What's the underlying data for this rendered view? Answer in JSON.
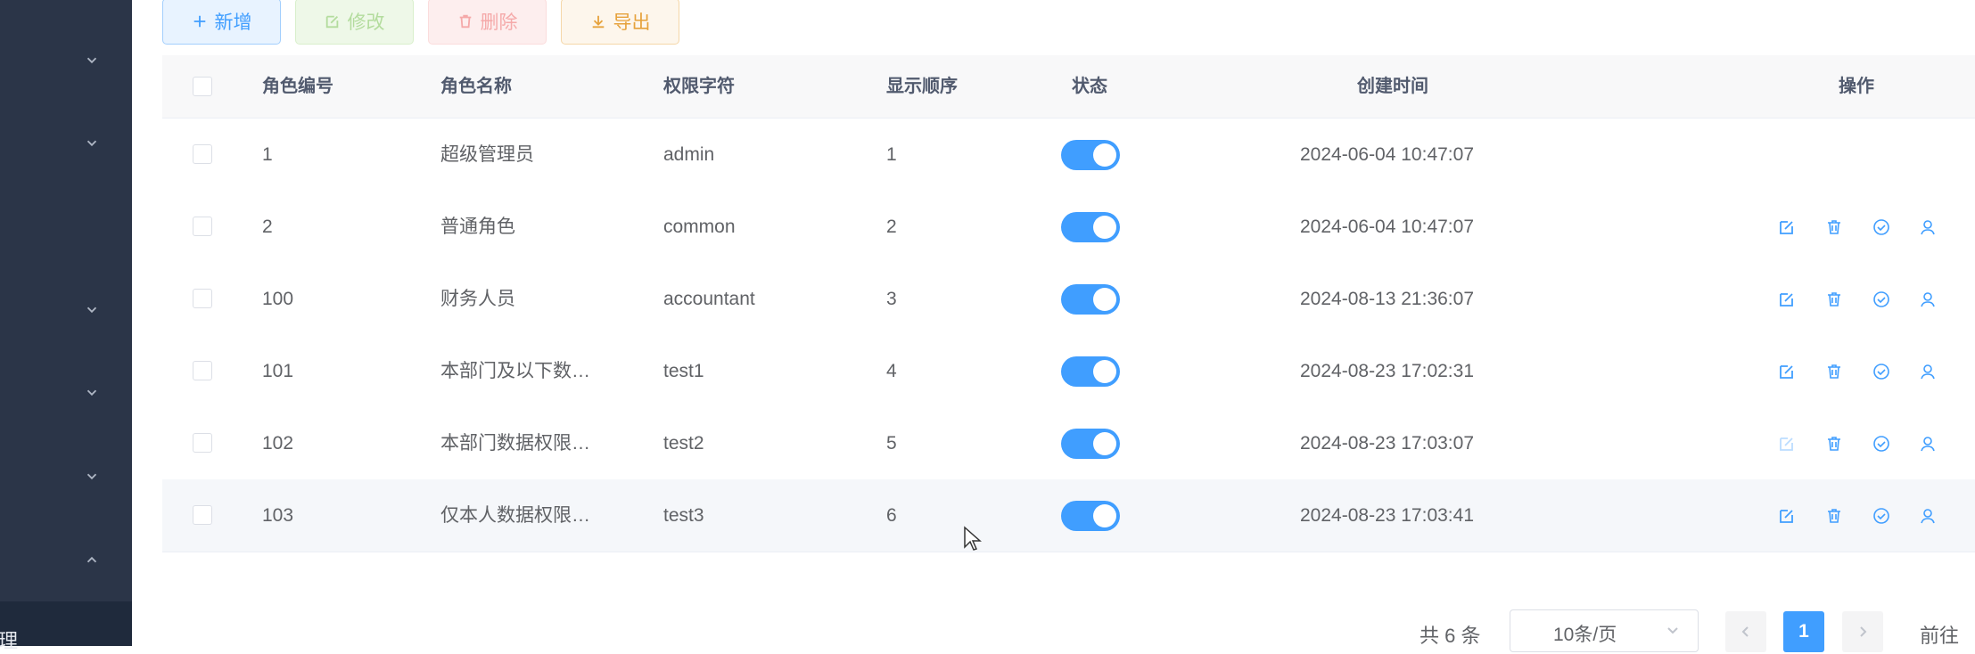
{
  "sidebar": {
    "active_label": "理"
  },
  "toolbar": {
    "add_label": "新增",
    "edit_label": "修改",
    "delete_label": "删除",
    "export_label": "导出"
  },
  "table": {
    "columns": {
      "role_id": "角色编号",
      "role_name": "角色名称",
      "role_key": "权限字符",
      "sort": "显示顺序",
      "status": "状态",
      "create_time": "创建时间",
      "actions": "操作"
    },
    "rows": [
      {
        "role_id": "1",
        "role_name": "超级管理员",
        "role_key": "admin",
        "sort": "1",
        "status_on": true,
        "create_time": "2024-06-04 10:47:07"
      },
      {
        "role_id": "2",
        "role_name": "普通角色",
        "role_key": "common",
        "sort": "2",
        "status_on": true,
        "create_time": "2024-06-04 10:47:07"
      },
      {
        "role_id": "100",
        "role_name": "财务人员",
        "role_key": "accountant",
        "sort": "3",
        "status_on": true,
        "create_time": "2024-08-13 21:36:07"
      },
      {
        "role_id": "101",
        "role_name": "本部门及以下数…",
        "role_key": "test1",
        "sort": "4",
        "status_on": true,
        "create_time": "2024-08-23 17:02:31"
      },
      {
        "role_id": "102",
        "role_name": "本部门数据权限…",
        "role_key": "test2",
        "sort": "5",
        "status_on": true,
        "create_time": "2024-08-23 17:03:07"
      },
      {
        "role_id": "103",
        "role_name": "仅本人数据权限…",
        "role_key": "test3",
        "sort": "6",
        "status_on": true,
        "create_time": "2024-08-23 17:03:41"
      }
    ]
  },
  "pagination": {
    "total_text": "共 6 条",
    "page_size": "10条/页",
    "current_page": "1",
    "goto_label": "前往"
  },
  "colors": {
    "primary": "#409eff",
    "sidebar_bg": "#2b3548",
    "success_light": "#b3dc9d",
    "danger_light": "#f5a9a9",
    "warning": "#e6a23c"
  }
}
